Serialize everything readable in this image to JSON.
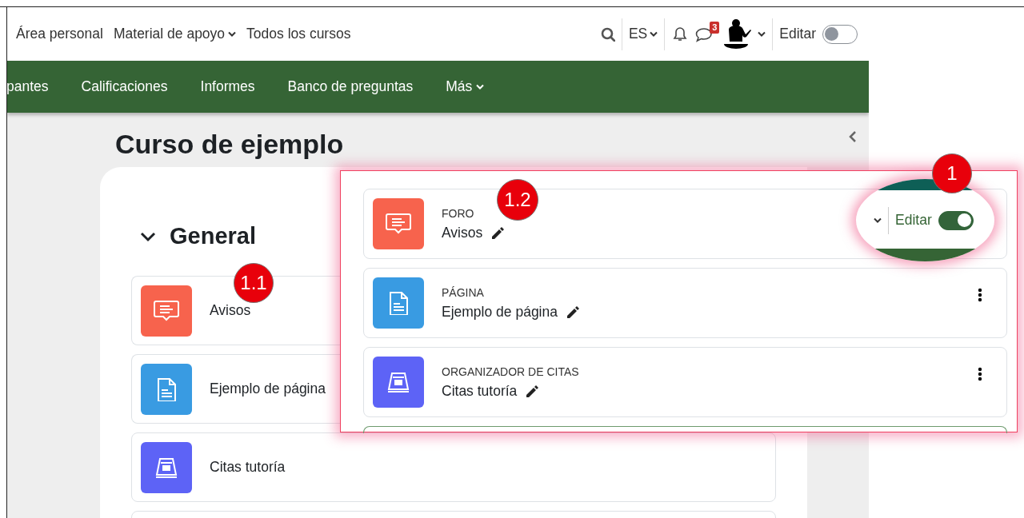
{
  "top_nav": {
    "links": [
      {
        "label": "Área personal",
        "dropdown": false
      },
      {
        "label": "Material de apoyo",
        "dropdown": true
      },
      {
        "label": "Todos los cursos",
        "dropdown": false
      }
    ],
    "language": "ES",
    "messages_badge": "3",
    "edit_label": "Editar",
    "edit_on": false
  },
  "course_nav": {
    "items": [
      {
        "label": "pantes",
        "dropdown": false
      },
      {
        "label": "Calificaciones",
        "dropdown": false
      },
      {
        "label": "Informes",
        "dropdown": false
      },
      {
        "label": "Banco de preguntas",
        "dropdown": false
      },
      {
        "label": "Más",
        "dropdown": true
      }
    ]
  },
  "course": {
    "title": "Curso de ejemplo",
    "section": {
      "title": "General",
      "expanded": true
    },
    "activities": [
      {
        "kind": "forum",
        "name": "Avisos",
        "callout": "1.1"
      },
      {
        "kind": "page",
        "name": "Ejemplo de página"
      },
      {
        "kind": "scheduler",
        "name": "Citas tutoría"
      }
    ]
  },
  "zoom_panel": {
    "activities": [
      {
        "kind": "forum",
        "type_label": "FORO",
        "name": "Avisos",
        "menu": false,
        "callout": "1.2"
      },
      {
        "kind": "page",
        "type_label": "PÁGINA",
        "name": "Ejemplo de página",
        "menu": true
      },
      {
        "kind": "scheduler",
        "type_label": "ORGANIZADOR DE CITAS",
        "name": "Citas tutoría",
        "menu": true
      }
    ],
    "magnifier": {
      "edit_label": "Editar",
      "edit_on": true,
      "callout": "1"
    }
  }
}
